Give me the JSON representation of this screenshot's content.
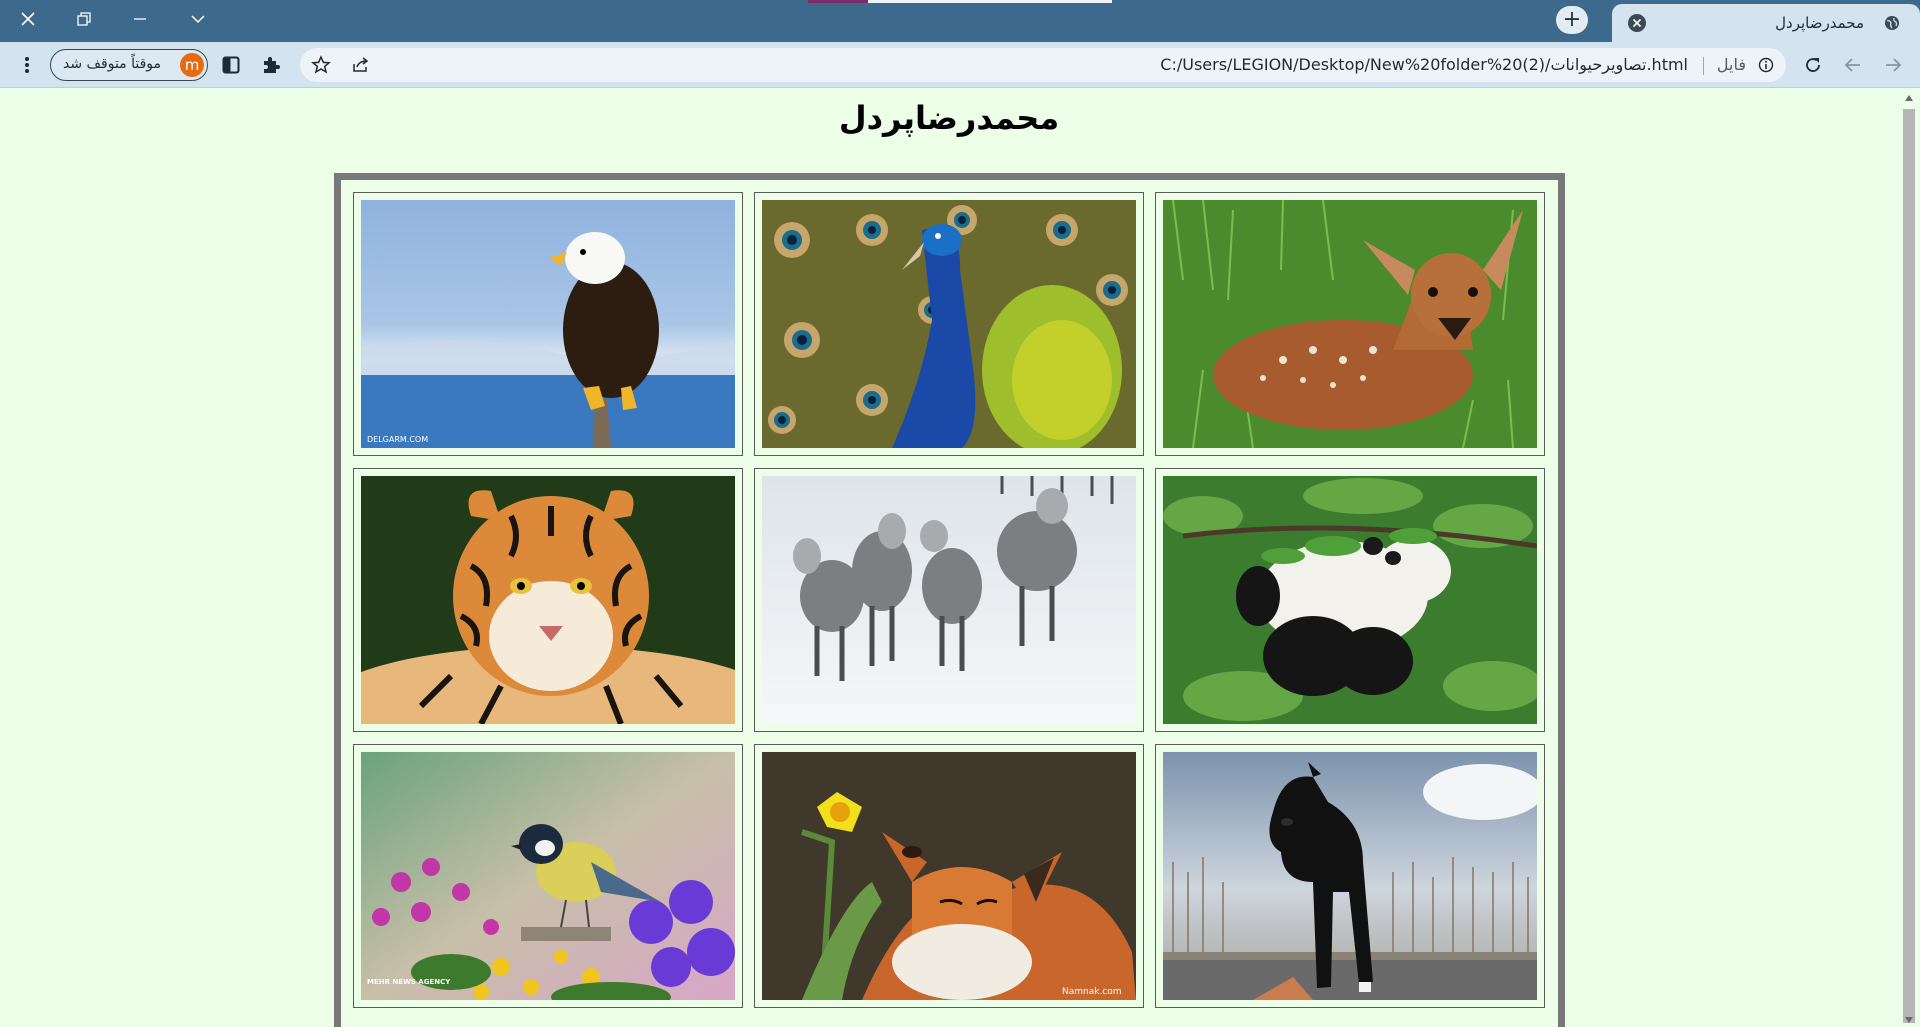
{
  "browser": {
    "tab_title": "محمدرضاپردل",
    "new_tab_label": "+",
    "address": {
      "scheme_label": "فایل",
      "url": "C:/Users/LEGION/Desktop/New%20folder%20(2)/تصاویرحیوانات.html"
    },
    "profile": {
      "status_label": "موقتاً متوقف شد",
      "avatar_letter": "m"
    },
    "colors": {
      "frame": "#3d6a8c",
      "toolbar": "#d3e3ef",
      "avatar": "#e86a10"
    }
  },
  "page": {
    "title": "محمدرضاپردل",
    "background": "#ecfde8",
    "gallery": [
      {
        "animal": "eagle",
        "watermark": "DELGARM.COM"
      },
      {
        "animal": "peacock",
        "watermark": ""
      },
      {
        "animal": "deer",
        "watermark": ""
      },
      {
        "animal": "tiger",
        "watermark": ""
      },
      {
        "animal": "wolves",
        "watermark": ""
      },
      {
        "animal": "panda",
        "watermark": ""
      },
      {
        "animal": "bird",
        "watermark": "MEHR NEWS AGENCY"
      },
      {
        "animal": "fox",
        "watermark": "Namnak.com"
      },
      {
        "animal": "horse",
        "watermark": ""
      }
    ]
  }
}
